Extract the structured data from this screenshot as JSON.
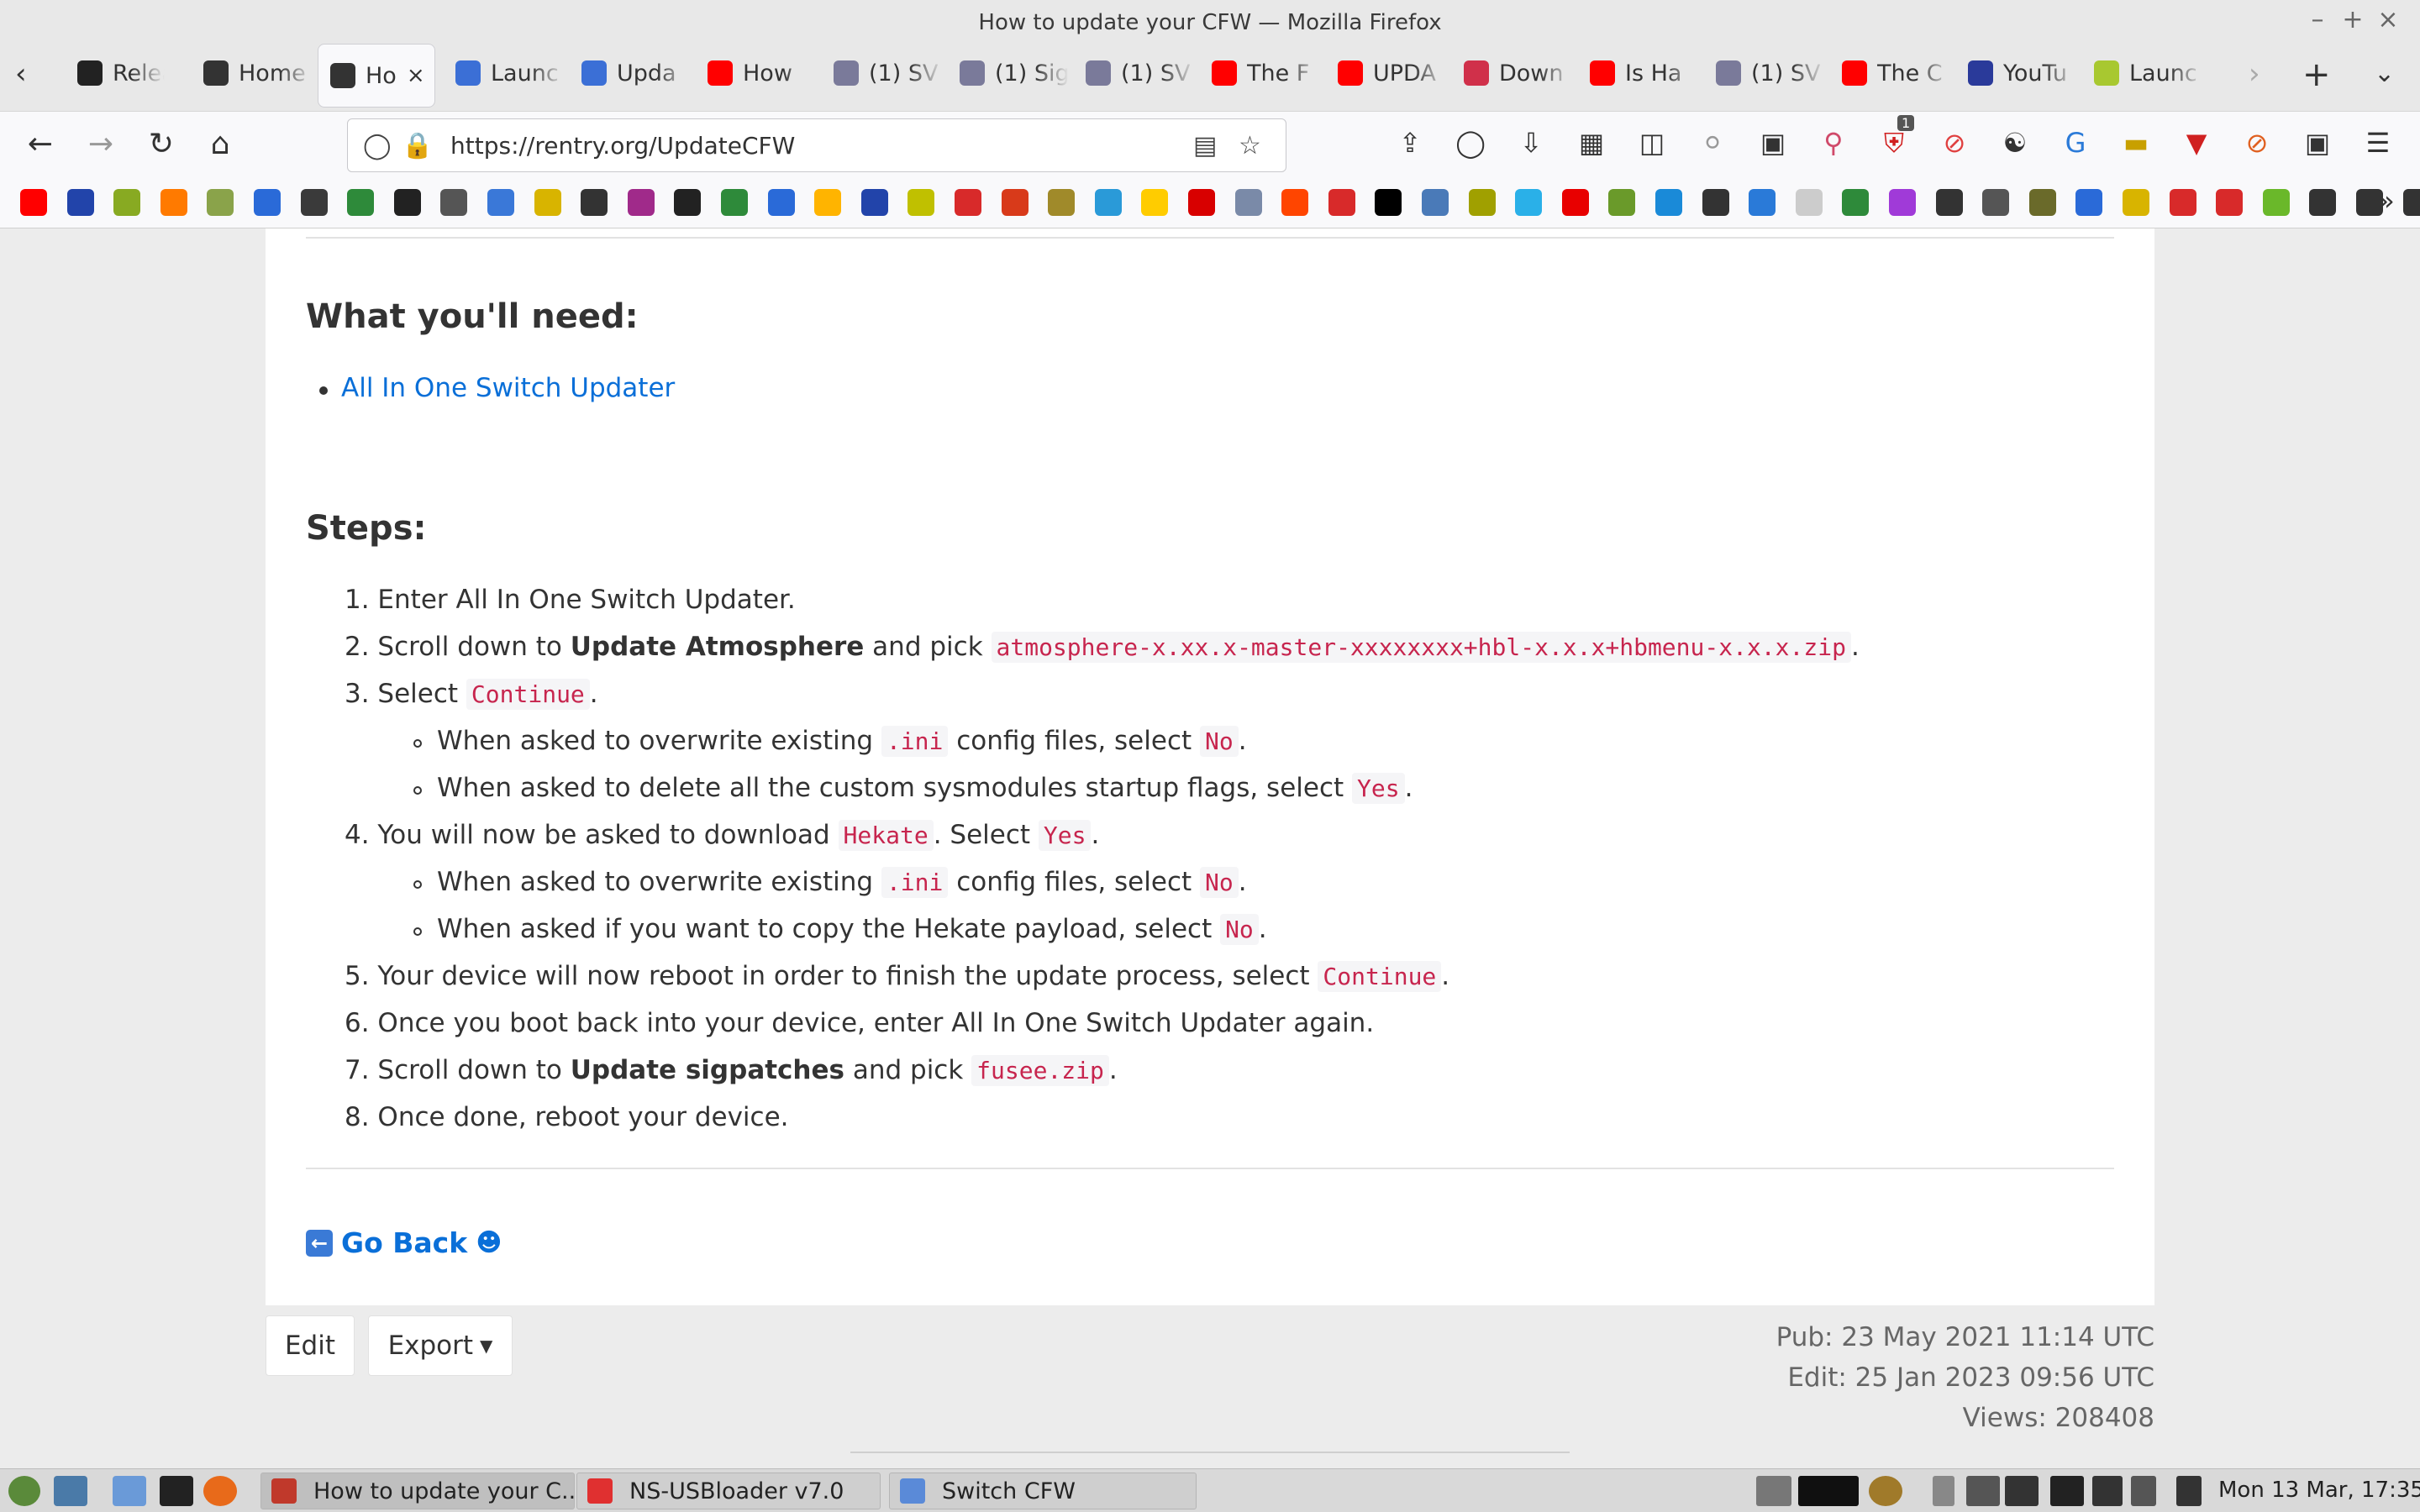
{
  "window": {
    "title": "How to update your CFW — Mozilla Firefox",
    "min": "–",
    "max": "+",
    "close": "×"
  },
  "tabs": [
    {
      "label": "Relea",
      "icon": "github-icon",
      "color": "#222222"
    },
    {
      "label": "Home",
      "icon": "rentry-icon",
      "color": "#333333"
    },
    {
      "label": "Ho",
      "icon": "rentry-icon",
      "color": "#333333",
      "active": true
    },
    {
      "label": "Launc",
      "icon": "h-icon",
      "color": "#3b6fd6"
    },
    {
      "label": "Upda",
      "icon": "h-icon",
      "color": "#3b6fd6"
    },
    {
      "label": "How",
      "icon": "youtube-icon",
      "color": "#ff0000"
    },
    {
      "label": "(1) SV",
      "icon": "reddit-cat-icon",
      "color": "#7a7a9a"
    },
    {
      "label": "(1) Sig",
      "icon": "reddit-cat-icon",
      "color": "#7a7a9a"
    },
    {
      "label": "(1) SV",
      "icon": "reddit-cat-icon",
      "color": "#7a7a9a"
    },
    {
      "label": "The F",
      "icon": "youtube-icon",
      "color": "#ff0000"
    },
    {
      "label": "UPDA",
      "icon": "youtube-icon",
      "color": "#ff0000"
    },
    {
      "label": "Down",
      "icon": "diamond-icon",
      "color": "#d0304a"
    },
    {
      "label": "Is Ha",
      "icon": "youtube-icon",
      "color": "#ff0000"
    },
    {
      "label": "(1) SV",
      "icon": "reddit-cat-icon",
      "color": "#7a7a9a"
    },
    {
      "label": "The C",
      "icon": "youtube-icon",
      "color": "#ff0000"
    },
    {
      "label": "YouTu",
      "icon": "brave-icon",
      "color": "#2a3a9a"
    },
    {
      "label": "Launc",
      "icon": "launch-icon",
      "color": "#a8c830"
    }
  ],
  "nav": {
    "url": "https://rentry.org/UpdateCFW"
  },
  "bookmark_colors": [
    "#ff0000",
    "#2244aa",
    "#88aa22",
    "#ff7a00",
    "#8aa34a",
    "#2a6ad8",
    "#3a3a3a",
    "#2e8a3a",
    "#222222",
    "#555555",
    "#3a78d8",
    "#d8b400",
    "#333333",
    "#a02a8a",
    "#222222",
    "#2e8a3a",
    "#2a6ad8",
    "#ffb400",
    "#2244aa",
    "#c0c000",
    "#d82a2a",
    "#d83a1a",
    "#a08a2a",
    "#2a9ad8",
    "#ffcc00",
    "#d80000",
    "#7a8aa8",
    "#ff4500",
    "#d82a2a",
    "#000000",
    "#4a7ab8",
    "#a0a000",
    "#2ab0e8",
    "#e80000",
    "#6a9a2a",
    "#1a8ad8",
    "#333333",
    "#2a7ad8",
    "#cccccc",
    "#2e8a3a",
    "#a03ad8",
    "#333333",
    "#555555",
    "#6a6a2a",
    "#2a6ad8",
    "#d8b400",
    "#d82a2a",
    "#d82a2a",
    "#6ab82a",
    "#333333",
    "#333333",
    "#333333"
  ],
  "content": {
    "need_heading": "What you'll need:",
    "need_link": "All In One Switch Updater",
    "steps_heading": "Steps:",
    "s1": "1. Enter All In One Switch Updater.",
    "s2_pre": "2. Scroll down to ",
    "s2_bold": "Update Atmosphere",
    "s2_mid": " and pick ",
    "s2_code": "atmosphere-x.xx.x-master-xxxxxxxx+hbl-x.x.x+hbmenu-x.x.x.zip",
    "s2_post": ".",
    "s3_pre": "3. Select ",
    "s3_code": "Continue",
    "s3_post": ".",
    "s3a_pre": "When asked to overwrite existing ",
    "s3a_code": ".ini",
    "s3a_mid": " config files, select ",
    "s3a_code2": "No",
    "s3a_post": ".",
    "s3b_pre": "When asked to delete all the custom sysmodules startup flags, select ",
    "s3b_code": "Yes",
    "s3b_post": ".",
    "s4_pre": "4. You will now be asked to download ",
    "s4_code": "Hekate",
    "s4_mid": ". Select ",
    "s4_code2": "Yes",
    "s4_post": ".",
    "s4a_pre": "When asked to overwrite existing ",
    "s4a_code": ".ini",
    "s4a_mid": " config files, select ",
    "s4a_code2": "No",
    "s4a_post": ".",
    "s4b_pre": "When asked if you want to copy the Hekate payload, select ",
    "s4b_code": "No",
    "s4b_post": ".",
    "s5_pre": "5. Your device will now reboot in order to finish the update process, select ",
    "s5_code": "Continue",
    "s5_post": ".",
    "s6": "6. Once you boot back into your device, enter All In One Switch Updater again.",
    "s7_pre": "7. Scroll down to ",
    "s7_bold": "Update sigpatches",
    "s7_mid": " and pick ",
    "s7_code": "fusee.zip",
    "s7_post": ".",
    "s8": "8. Once done, reboot your device.",
    "go_back": "Go Back"
  },
  "footer": {
    "edit": "Edit",
    "export": "Export",
    "pub": "Pub: 23 May 2021 11:14 UTC",
    "edited": "Edit: 25 Jan 2023 09:56 UTC",
    "views": "Views: 208408"
  },
  "taskbar": {
    "tasks": [
      {
        "label": "How to update your C...",
        "color": "#c0392b",
        "active": true
      },
      {
        "label": "NS-USBloader v7.0",
        "color": "#e03030"
      },
      {
        "label": "Switch CFW",
        "color": "#5a8ad8"
      }
    ],
    "clock": "Mon 13 Mar, 17:35",
    "badge_count": "1"
  }
}
